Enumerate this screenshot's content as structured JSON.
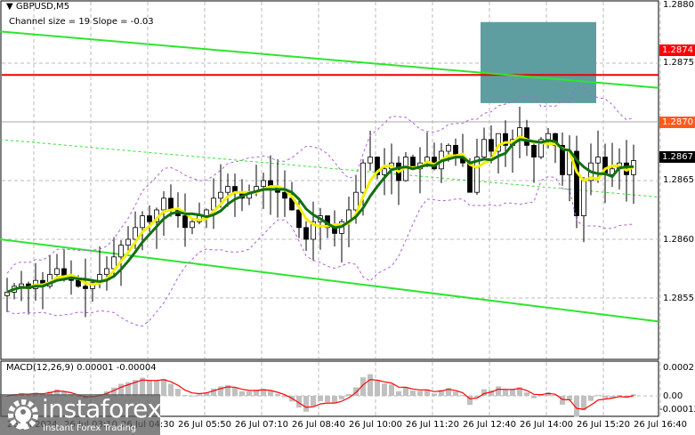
{
  "header": {
    "symbol": "GBPUSD,M5",
    "channel": "Channel size = 19 Slope = -0.03"
  },
  "macd": {
    "label": "MACD(12,26,9) 0.00001 -0.00004",
    "axis": [
      "0.00021",
      "0.00",
      "-0.00012"
    ]
  },
  "price_axis": [
    "1.2880",
    "1.2875",
    "1.2870",
    "1.2865",
    "1.2860",
    "1.2855"
  ],
  "tags": {
    "red": {
      "label": "1.2874",
      "color": "#ff0000"
    },
    "orange": {
      "label": "1.2870",
      "color": "#ff5a1e"
    },
    "current": {
      "label": "1.2867",
      "color": "#000000"
    }
  },
  "time_axis": [
    "26 Jul 2024",
    "26 Jul 03:10",
    "26 Jul 04:30",
    "26 Jul 05:50",
    "26 Jul 07:10",
    "26 Jul 08:40",
    "26 Jul 10:00",
    "26 Jul 11:20",
    "26 Jul 12:40",
    "26 Jul 14:00",
    "26 Jul 15:20",
    "26 Jul 16:40"
  ],
  "logo": {
    "name": "instaforex",
    "tagline": "Instant Forex Trading"
  },
  "chart_data": {
    "type": "candlestick",
    "symbol": "GBPUSD",
    "timeframe": "M5",
    "ylim": [
      1.285,
      1.288
    ],
    "closes": [
      1.28555,
      1.2856,
      1.28562,
      1.28558,
      1.28565,
      1.2856,
      1.2857,
      1.28575,
      1.28568,
      1.28565,
      1.2856,
      1.28558,
      1.28563,
      1.2857,
      1.28575,
      1.28585,
      1.28595,
      1.286,
      1.2861,
      1.2862,
      1.28615,
      1.28625,
      1.28635,
      1.28625,
      1.2862,
      1.2861,
      1.28615,
      1.2862,
      1.28625,
      1.28635,
      1.2864,
      1.28645,
      1.2864,
      1.28635,
      1.2864,
      1.28645,
      1.2865,
      1.28645,
      1.2864,
      1.28635,
      1.28625,
      1.2861,
      1.286,
      1.28615,
      1.2862,
      1.2861,
      1.28605,
      1.28615,
      1.28625,
      1.2864,
      1.28665,
      1.2867,
      1.28655,
      1.2866,
      1.28665,
      1.2865,
      1.2867,
      1.2866,
      1.28665,
      1.2867,
      1.2866,
      1.28675,
      1.2868,
      1.2867,
      1.28665,
      1.2864,
      1.2867,
      1.28685,
      1.28675,
      1.2869,
      1.2868,
      1.28685,
      1.28695,
      1.2868,
      1.2867,
      1.28685,
      1.2869,
      1.2868,
      1.28655,
      1.28675,
      1.2862,
      1.2865,
      1.28665,
      1.2867,
      1.28655,
      1.2866,
      1.28665,
      1.28655,
      1.28667
    ],
    "levels": {
      "resistance": 1.2874,
      "line": 1.287
    },
    "channel": {
      "upper": [
        1.28777,
        1.28729
      ],
      "middle": [
        1.28685,
        1.28636
      ],
      "lower": [
        1.286,
        1.2853
      ]
    },
    "target_zone": [
      1.28716,
      1.28785
    ]
  }
}
